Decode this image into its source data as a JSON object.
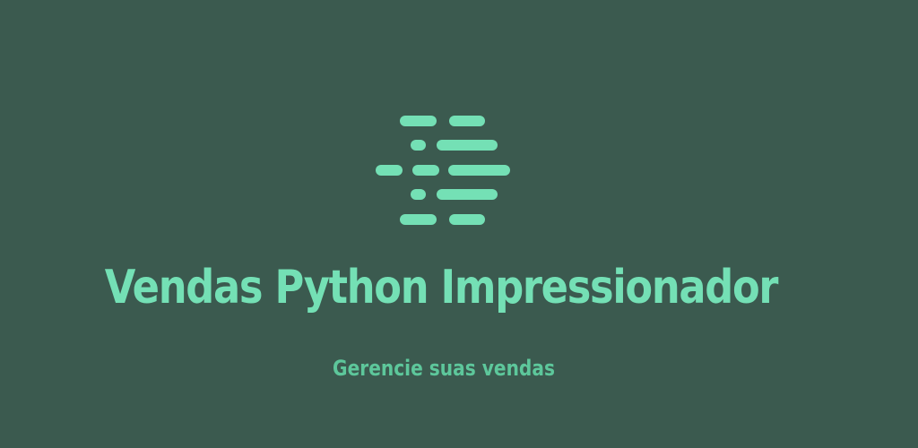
{
  "banner": {
    "title": "Vendas Python Impressionador",
    "subtitle": "Gerencie suas vendas",
    "background_color": "#3b5a4f",
    "accent_color": "#74e0b5",
    "subtitle_color": "#5dc79b",
    "logo_icon": "code-lines-icon"
  }
}
